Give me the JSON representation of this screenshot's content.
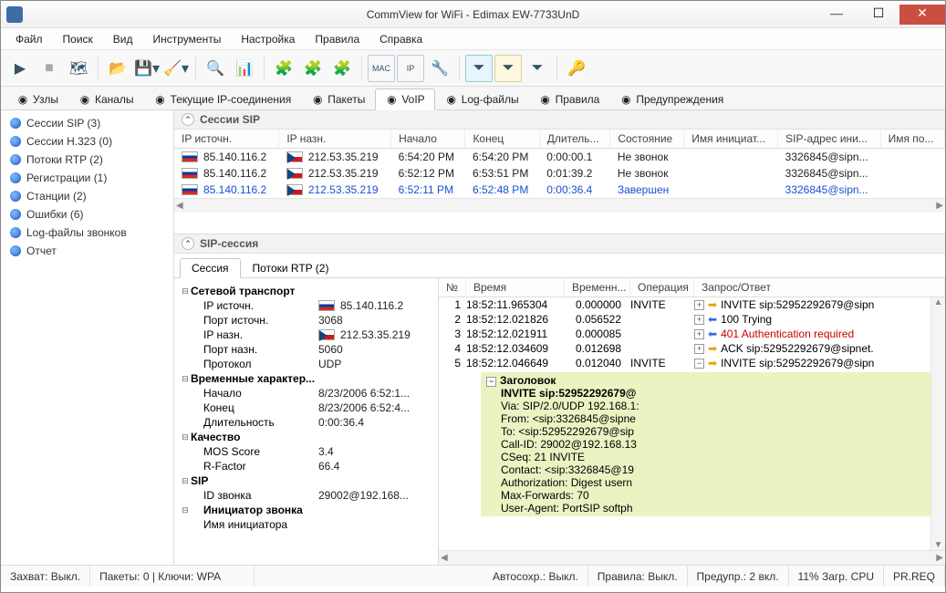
{
  "window": {
    "title": "CommView for WiFi - Edimax EW-7733UnD"
  },
  "menu": [
    "Файл",
    "Поиск",
    "Вид",
    "Инструменты",
    "Настройка",
    "Правила",
    "Справка"
  ],
  "main_tabs": [
    {
      "label": "Узлы",
      "active": false
    },
    {
      "label": "Каналы",
      "active": false
    },
    {
      "label": "Текущие IP-соединения",
      "active": false
    },
    {
      "label": "Пакеты",
      "active": false
    },
    {
      "label": "VoIP",
      "active": true
    },
    {
      "label": "Log-файлы",
      "active": false
    },
    {
      "label": "Правила",
      "active": false
    },
    {
      "label": "Предупреждения",
      "active": false
    }
  ],
  "sidebar": [
    "Сессии SIP  (3)",
    "Сессии H.323 (0)",
    "Потоки RTP (2)",
    "Регистрации (1)",
    "Станции (2)",
    "Ошибки (6)",
    "Log-файлы звонков",
    "Отчет"
  ],
  "sessions_panel": {
    "title": "Сессии SIP",
    "columns": [
      "IP источн.",
      "IP назн.",
      "Начало",
      "Конец",
      "Длитель...",
      "Состояние",
      "Имя инициат...",
      "SIP-адрес ини...",
      "Имя по..."
    ],
    "rows": [
      {
        "src": "85.140.116.2",
        "dst": "212.53.35.219",
        "start": "6:54:20 PM",
        "end": "6:54:20 PM",
        "dur": "0:00:00.1",
        "state": "Не звонок",
        "init": "",
        "sip": "3326845@sipn..."
      },
      {
        "src": "85.140.116.2",
        "dst": "212.53.35.219",
        "start": "6:52:12 PM",
        "end": "6:53:51 PM",
        "dur": "0:01:39.2",
        "state": "Не звонок",
        "init": "",
        "sip": "3326845@sipn..."
      },
      {
        "src": "85.140.116.2",
        "dst": "212.53.35.219",
        "start": "6:52:11 PM",
        "end": "6:52:48 PM",
        "dur": "0:00:36.4",
        "state": "Завершен",
        "init": "",
        "sip": "3326845@sipn...",
        "sel": true
      }
    ]
  },
  "sip_panel": {
    "title": "SIP-сессия",
    "subtabs": [
      {
        "label": "Сессия",
        "active": true
      },
      {
        "label": "Потоки RTP (2)",
        "active": false
      }
    ],
    "details": [
      {
        "type": "head",
        "label": "Сетевой транспорт"
      },
      {
        "label": "IP источн.",
        "value": "85.140.116.2",
        "flag": "ru"
      },
      {
        "label": "Порт источн.",
        "value": "3068"
      },
      {
        "label": "IP назн.",
        "value": "212.53.35.219",
        "flag": "cz"
      },
      {
        "label": "Порт назн.",
        "value": "5060"
      },
      {
        "label": "Протокол",
        "value": "UDP"
      },
      {
        "type": "head",
        "label": "Временные характер..."
      },
      {
        "label": "Начало",
        "value": "8/23/2006 6:52:1..."
      },
      {
        "label": "Конец",
        "value": "8/23/2006 6:52:4..."
      },
      {
        "label": "Длительность",
        "value": "0:00:36.4"
      },
      {
        "type": "head",
        "label": "Качество"
      },
      {
        "label": "MOS Score",
        "value": "3.4"
      },
      {
        "label": "R-Factor",
        "value": "66.4"
      },
      {
        "type": "head",
        "label": "SIP"
      },
      {
        "label": "ID звонка",
        "value": "29002@192.168..."
      },
      {
        "type": "head",
        "label": "Инициатор звонка",
        "indent": true
      },
      {
        "label": "Имя инициатора",
        "value": ""
      }
    ],
    "msg_cols": [
      "№",
      "Время",
      "Временн...",
      "Операция",
      "Запрос/Ответ"
    ],
    "msgs": [
      {
        "n": "1",
        "t": "18:52:11.965304",
        "dt": "0.000000",
        "op": "INVITE",
        "dir": "out",
        "text": "INVITE sip:52952292679@sipn"
      },
      {
        "n": "2",
        "t": "18:52:12.021826",
        "dt": "0.056522",
        "op": "",
        "dir": "in",
        "text": "100 Trying"
      },
      {
        "n": "3",
        "t": "18:52:12.021911",
        "dt": "0.000085",
        "op": "",
        "dir": "in",
        "text": "401 Authentication required",
        "red": true
      },
      {
        "n": "4",
        "t": "18:52:12.034609",
        "dt": "0.012698",
        "op": "",
        "dir": "out",
        "text": "ACK sip:52952292679@sipnet."
      },
      {
        "n": "5",
        "t": "18:52:12.046649",
        "dt": "0.012040",
        "op": "INVITE",
        "dir": "out",
        "text": "INVITE sip:52952292679@sipn",
        "expanded": true
      }
    ],
    "headers": {
      "title": "Заголовок",
      "lines": [
        "INVITE sip:52952292679@",
        "Via: SIP/2.0/UDP 192.168.1:",
        "From: <sip:3326845@sipne",
        "To: <sip:52952292679@sip",
        "Call-ID: 29002@192.168.13",
        "CSeq: 21 INVITE",
        "Contact: <sip:3326845@19",
        "Authorization: Digest usern",
        "Max-Forwards: 70",
        "User-Agent: PortSIP softph"
      ]
    }
  },
  "status": [
    "Захват: Выкл.",
    "Пакеты: 0 | Ключи: WPA",
    "Автосохр.: Выкл.",
    "Правила: Выкл.",
    "Предупр.: 2 вкл.",
    "11% Загр. CPU",
    "PR.REQ"
  ]
}
